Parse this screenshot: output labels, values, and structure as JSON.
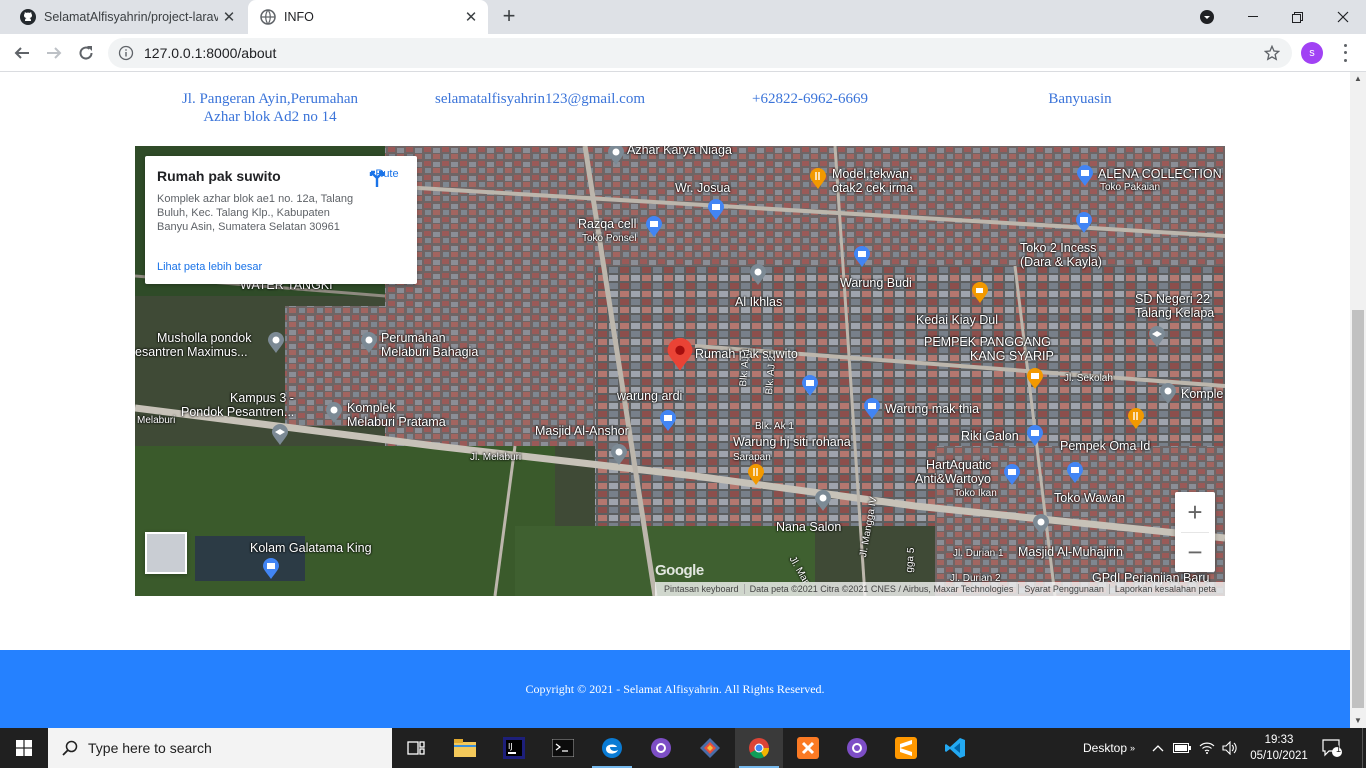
{
  "browser": {
    "tabs": [
      {
        "title": "SelamatAlfisyahrin/project-larave",
        "active": false
      },
      {
        "title": "INFO",
        "active": true
      }
    ],
    "url": "127.0.0.1:8000/about",
    "profile_initial": "s"
  },
  "contact": {
    "address": "Jl. Pangeran Ayin,Perumahan Azhar blok Ad2 no 14",
    "email": "selamatalfisyahrin123@gmail.com",
    "phone": "+62822-6962-6669",
    "city": "Banyuasin"
  },
  "map": {
    "place_name": "Rumah pak suwito",
    "place_address": "Komplek azhar blok ae1 no. 12a, Talang Buluh, Kec. Talang Klp., Kabupaten Banyu Asin, Sumatera Selatan 30961",
    "route_label": "Rute",
    "bigger_map_link": "Lihat peta lebih besar",
    "labels": [
      "Azhar Karya Niaga",
      "Wr. Josua",
      "Model,tekwan,",
      "otak2 cek irma",
      "ALENA COLLECTION",
      "Toko Pakaian",
      "Razqa cell",
      "Toko Ponsel",
      "Toko 2 Incess",
      "(Dara & Kayla)",
      "Warung Budi",
      "Al Ikhlas",
      "Kedai Kiay Dul",
      "SD Negeri 22",
      "Talang Kelapa",
      "WATER TANGKI",
      "PEMPEK PANGGANG",
      "KANG SYARIP",
      "Musholla pondok",
      "esantren Maximus...",
      "Perumahan",
      "Melaburi Bahagia",
      "Rumah pak suwito",
      "Jl. Sekolah",
      "warung ardi",
      "Kampus 3 -",
      "Pondok Pesantren...",
      "Komplek",
      "Melaburi Pratama",
      "Warung mak thia",
      "Komple",
      "Masjid Al-Anshor",
      "Riki Galon",
      "Warung hj siti rohana",
      "Sarapan",
      "Pempek Oma Id",
      "Jl. Melaburi",
      "Melaburi",
      "HartAquatic",
      "Anti&Wartoyo",
      "Toko Ikan",
      "Toko Wawan",
      "Nana Salon",
      "Kolam Galatama King",
      "Masjid Al-Muhajirin",
      "Jl. Durian 1",
      "Jl. Durian 2",
      "GPdI Perjanjian Baru",
      "Ak",
      "Blk. AJ 1",
      "Blk. AJ 2",
      "Blk. Ak 1",
      "Jl. Mangga IV",
      "Jl. Mar",
      "gga 5"
    ],
    "attribution": [
      "Pintasan keyboard",
      "Data peta ©2021 Citra ©2021 CNES / Airbus, Maxar Technologies",
      "Syarat Penggunaan",
      "Laporkan kesalahan peta"
    ],
    "google_logo": "Google"
  },
  "footer": {
    "copyright": "Copyright © 2021 - Selamat Alfisyahrin. All Rights Reserved."
  },
  "taskbar": {
    "search_placeholder": "Type here to search",
    "desktop_label": "Desktop",
    "time": "19:33",
    "date": "05/10/2021",
    "notification_count": "1"
  }
}
